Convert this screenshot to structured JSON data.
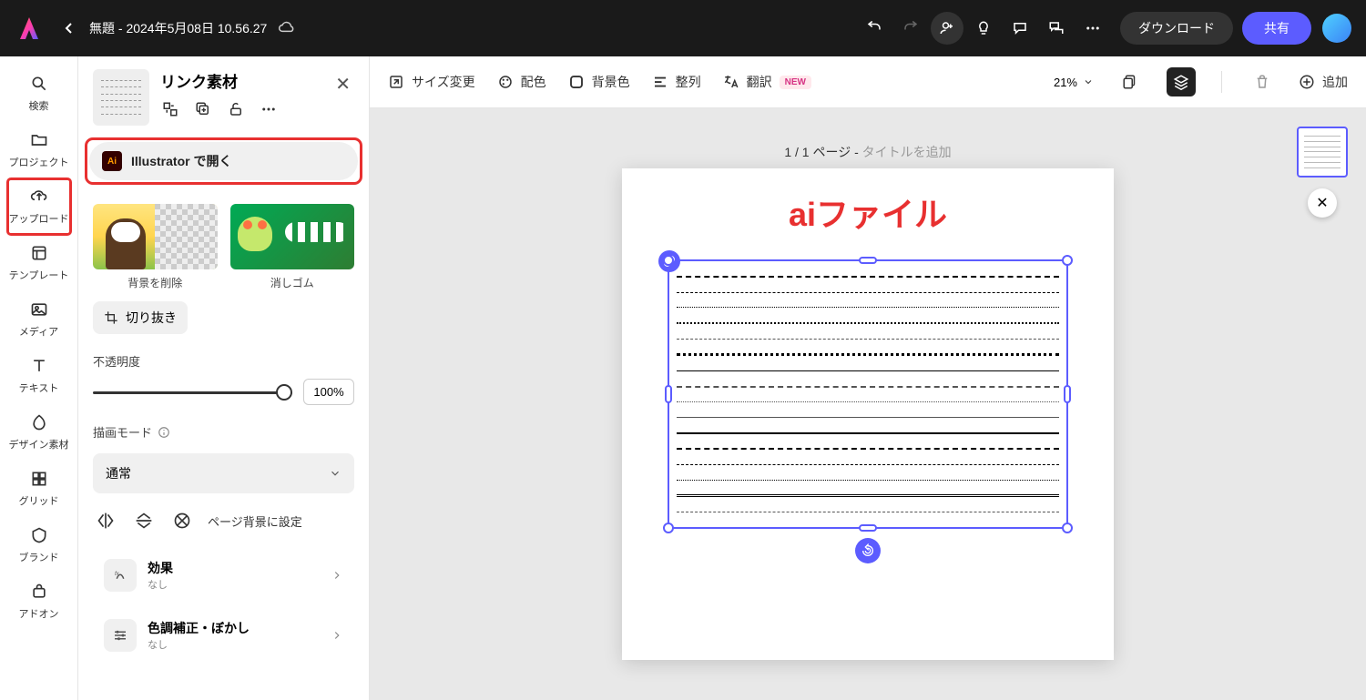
{
  "header": {
    "doc_title": "無題 - 2024年5月08日 10.56.27",
    "download_label": "ダウンロード",
    "share_label": "共有"
  },
  "rail": {
    "items": [
      {
        "label": "検索"
      },
      {
        "label": "プロジェクト"
      },
      {
        "label": "アップロード"
      },
      {
        "label": "テンプレート"
      },
      {
        "label": "メディア"
      },
      {
        "label": "テキスト"
      },
      {
        "label": "デザイン素材"
      },
      {
        "label": "グリッド"
      },
      {
        "label": "ブランド"
      },
      {
        "label": "アドオン"
      }
    ]
  },
  "panel": {
    "title": "リンク素材",
    "open_in_illustrator": "Illustrator で開く",
    "actions": {
      "remove_bg": "背景を削除",
      "eraser": "消しゴム"
    },
    "crop_label": "切り抜き",
    "opacity_label": "不透明度",
    "opacity_value": "100%",
    "blend_label": "描画モード",
    "blend_value": "通常",
    "set_bg_label": "ページ背景に設定",
    "effects": {
      "title": "効果",
      "sub": "なし"
    },
    "adjust": {
      "title": "色調補正・ぼかし",
      "sub": "なし"
    }
  },
  "toolbar": {
    "resize": "サイズ変更",
    "color": "配色",
    "bg": "背景色",
    "align": "整列",
    "translate": "翻訳",
    "translate_badge": "NEW",
    "zoom": "21%",
    "add": "追加"
  },
  "canvas": {
    "page_indicator": "1 / 1 ページ",
    "page_title_placeholder": "タイトルを追加",
    "red_text": "aiファイル"
  }
}
